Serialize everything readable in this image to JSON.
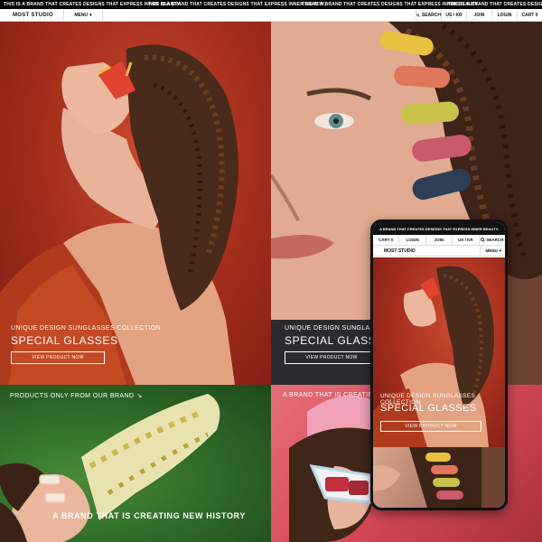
{
  "announcement": {
    "text": "THIS IS A BRAND THAT CREATES DESIGNS THAT EXPRESS INNER BEAUTY."
  },
  "header": {
    "logo": "MOST STUDIO",
    "menu_label": "MENU",
    "search_label": "SEARCH",
    "locale_label": "US / KR",
    "join_label": "JOIN",
    "login_label": "LOGIN",
    "cart_label": "CART 0"
  },
  "hero_left": {
    "subtitle": "UNIQUE DESIGN SUNGLASSES COLLECTION",
    "title": "SPECIAL GLASSES",
    "button": "VIEW PRODUCT NOW"
  },
  "hero_right": {
    "subtitle": "UNIQUE DESIGN SUNGLASSES COLLECTION",
    "title": "SPECIAL GLASSES",
    "button": "VIEW PRODUCT NOW"
  },
  "bottom_left": {
    "label": "PRODUCTS ONLY FROM OUR BRAND",
    "tagline": "A BRAND THAT IS CREATING NEW HISTORY"
  },
  "bottom_right": {
    "label": "A BRAND THAT IS CREATING NEW HISTORY"
  },
  "mobile": {
    "announcement": "A BRAND THAT CREATES DESIGNS THAT EXPRESS INNER BEAUTY.",
    "top_row": [
      "CART 0",
      "LOGIN",
      "JOIN",
      "US / KR",
      "SEARCH"
    ],
    "logo": "MOST STUDIO",
    "menu_label": "MENU",
    "subtitle": "UNIQUE DESIGN SUNGLASSES COLLECTION",
    "title": "SPECIAL GLASSES",
    "button": "VIEW PRODUCT NOW"
  }
}
